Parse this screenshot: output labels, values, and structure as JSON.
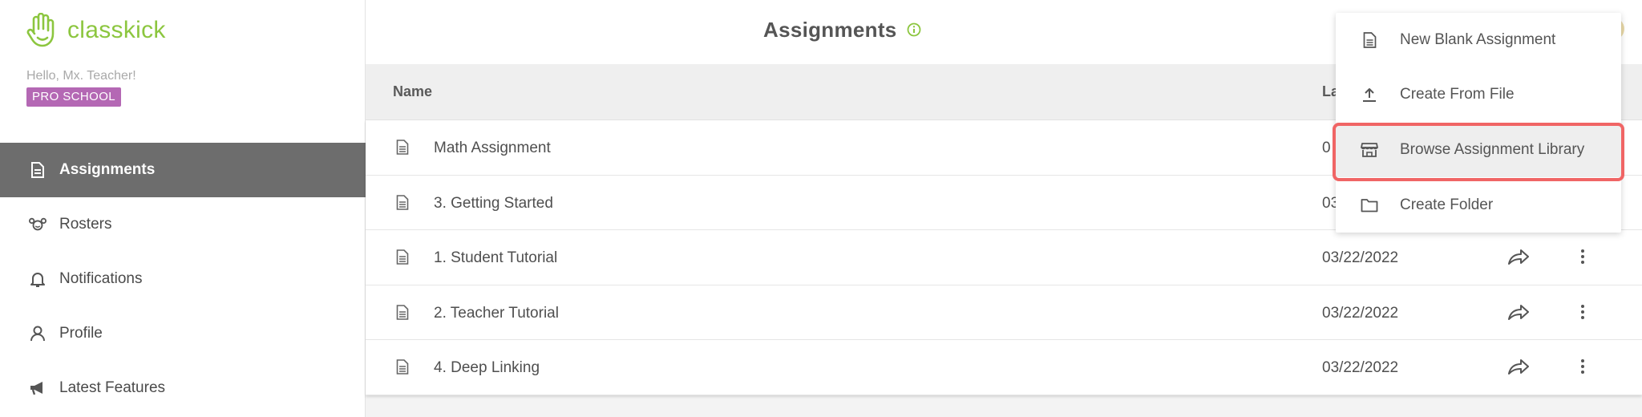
{
  "app": {
    "logo_text": "classkick",
    "greeting": "Hello, Mx. Teacher!",
    "plan_badge": "PRO SCHOOL",
    "accent_color": "#8cc63f",
    "badge_color": "#b468b4"
  },
  "sidebar": {
    "items": [
      {
        "label": "Assignments",
        "icon": "document-icon",
        "active": true
      },
      {
        "label": "Rosters",
        "icon": "roster-icon",
        "active": false
      },
      {
        "label": "Notifications",
        "icon": "bell-icon",
        "active": false
      },
      {
        "label": "Profile",
        "icon": "person-icon",
        "active": false
      },
      {
        "label": "Latest Features",
        "icon": "megaphone-icon",
        "active": false
      }
    ]
  },
  "header": {
    "title": "Assignments",
    "info_icon": "info-icon"
  },
  "table": {
    "columns": [
      "Name",
      "La"
    ],
    "rows": [
      {
        "name": "Math Assignment",
        "date": "0"
      },
      {
        "name": "3. Getting Started",
        "date": "03"
      },
      {
        "name": "1. Student Tutorial",
        "date": "03/22/2022"
      },
      {
        "name": "2. Teacher Tutorial",
        "date": "03/22/2022"
      },
      {
        "name": "4. Deep Linking",
        "date": "03/22/2022"
      }
    ]
  },
  "menu": {
    "items": [
      {
        "label": "New Blank Assignment",
        "icon": "document-icon"
      },
      {
        "label": "Create From File",
        "icon": "upload-icon"
      },
      {
        "label": "Browse Assignment Library",
        "icon": "store-icon",
        "highlighted": true
      },
      {
        "label": "Create Folder",
        "icon": "folder-icon"
      }
    ],
    "highlight_color": "#f06565"
  }
}
